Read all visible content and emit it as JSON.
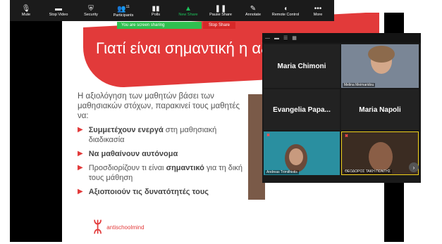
{
  "toolbar": {
    "items": [
      {
        "label": "Mute",
        "icon": "microphone-icon"
      },
      {
        "label": "Stop Video",
        "icon": "camera-icon"
      },
      {
        "label": "Security",
        "icon": "shield-icon"
      },
      {
        "label": "Participants",
        "icon": "participants-icon",
        "count": "11"
      },
      {
        "label": "Polls",
        "icon": "polls-icon"
      },
      {
        "label": "New Share",
        "icon": "share-icon"
      },
      {
        "label": "Pause Share",
        "icon": "pause-icon"
      },
      {
        "label": "Annotate",
        "icon": "pen-icon"
      },
      {
        "label": "Remote Control",
        "icon": "mouse-icon"
      },
      {
        "label": "More",
        "icon": "more-icon"
      }
    ]
  },
  "share_banner": {
    "text": "You are screen sharing",
    "stop_label": "Stop Share"
  },
  "slide": {
    "title": "Γιατί είναι σημαντική η αξ",
    "paragraph": "Η αξιολόγηση των μαθητών βάσει των μαθησιακών στόχων, παρακινεί τους μαθητές να:",
    "bullets": [
      {
        "bold": "Συμμετέχουν ενεργά",
        "rest": " στη μαθησιακή διαδικασία"
      },
      {
        "bold": "Να μαθαίνουν αυτόνομα",
        "rest": ""
      },
      {
        "pre": "Προσδιορίζουν τι είναι ",
        "bold": "σημαντικό",
        "rest": " για τη δική τους μάθηση"
      },
      {
        "bold": "Αξιοποιούν τις δυνατότητές τους",
        "rest": ""
      }
    ],
    "logo_text": "antischoolmind"
  },
  "participants": [
    {
      "name": "Maria Chimoni",
      "video": false
    },
    {
      "name": "Melina Meimaridou",
      "video": true
    },
    {
      "name": "Evangelia Papa...",
      "video": false
    },
    {
      "name": "Maria Napoli",
      "video": false
    },
    {
      "name": "Andreas Trimithiotis",
      "video": true
    },
    {
      "name": "ΘΕΟΔΟΡΟΣ ΤΑΚΗ ΠΟΝΤΗΣ",
      "video": true
    }
  ],
  "colors": {
    "accent_red": "#e23a3a",
    "share_green": "#2fbf4f",
    "toolbar_bg": "#1b1b1b",
    "active_speaker": "#f2d21a"
  }
}
